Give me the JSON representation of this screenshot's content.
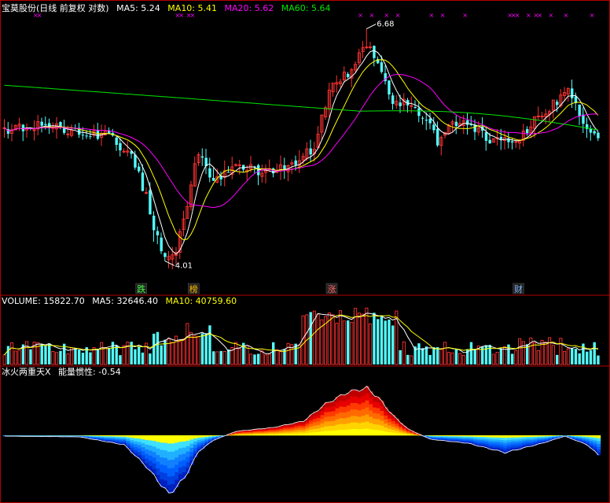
{
  "header": {
    "stock_name": "宝莫股份(日线 前复权 对数)",
    "ma5": "MA5: 5.24",
    "ma10": "MA10: 5.41",
    "ma20": "MA20: 5.62",
    "ma60": "MA60: 5.64"
  },
  "volume_header": {
    "volume": "VOLUME: 15822.70",
    "ma5": "MA5: 32646.40",
    "ma10": "MA10: 40759.60"
  },
  "indicator_header": {
    "name": "冰火两重天X",
    "inertia": "能量惯性: -0.54"
  },
  "colors": {
    "up": "#ff3232",
    "down": "#54fcfc",
    "ma5": "#ffffff",
    "ma10": "#ffff00",
    "ma20": "#ff00ff",
    "ma60": "#00e600",
    "border": "#b40000"
  },
  "chart_data": {
    "type": "candlestick",
    "price_high_label": "6.68",
    "price_low_label": "4.01",
    "event_markers": [
      {
        "label": "跌",
        "index": 37,
        "color": "#44ff44"
      },
      {
        "label": "榜",
        "index": 51,
        "color": "#ffbf00"
      },
      {
        "label": "涨",
        "index": 88,
        "color": "#ff6666"
      },
      {
        "label": "财",
        "index": 138,
        "color": "#7fb8ff"
      }
    ],
    "volume_current": 15822.7,
    "volume_ma5": 32646.4,
    "volume_ma10": 40759.6,
    "energy_inertia": -0.54
  }
}
